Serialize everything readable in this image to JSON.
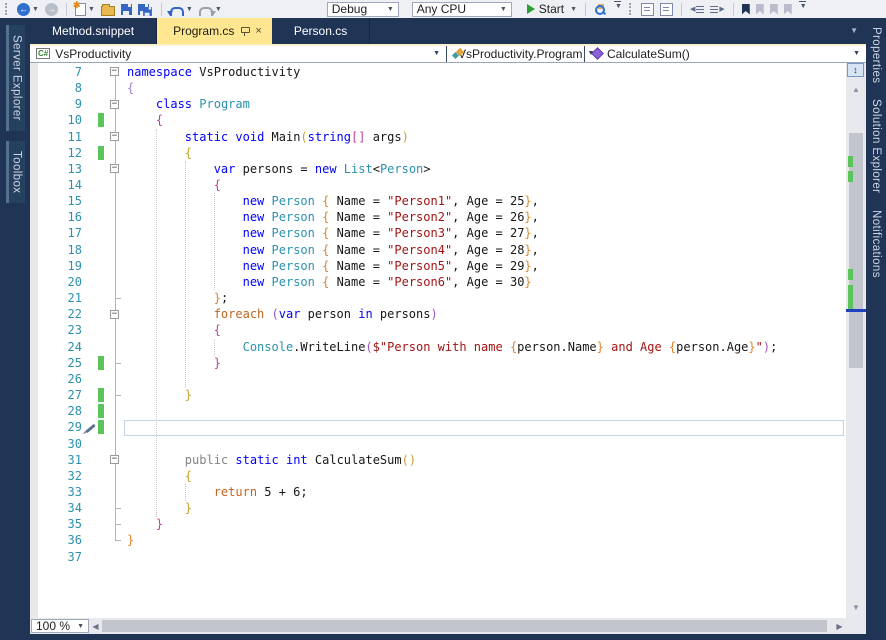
{
  "toolbar": {
    "debug_target": "Debug",
    "platform": "Any CPU",
    "start_label": "Start"
  },
  "tabs": [
    {
      "label": "Method.snippet",
      "active": false
    },
    {
      "label": "Program.cs",
      "active": true
    },
    {
      "label": "Person.cs",
      "active": false
    }
  ],
  "navbar": {
    "project": "VsProductivity",
    "type": "VsProductivity.Program",
    "member": "CalculateSum()",
    "project_icon_text": "C#"
  },
  "left_panels": [
    "Server Explorer",
    "Toolbox"
  ],
  "right_panels": [
    "Properties",
    "Solution Explorer",
    "Notifications"
  ],
  "statusbar": {
    "zoom_level": "100 %"
  },
  "icons": {
    "fold_expanded": "−"
  },
  "editor": {
    "caret_line": 29,
    "lines": [
      {
        "n": 7,
        "fold": true,
        "tokens": [
          [
            "kw",
            "namespace"
          ],
          [
            "pl",
            " VsProductivity"
          ]
        ]
      },
      {
        "n": 8,
        "tokens": [
          [
            "bl",
            "{"
          ]
        ]
      },
      {
        "n": 9,
        "fold": true,
        "tokens": [
          [
            "pl",
            "    "
          ],
          [
            "kw",
            "class"
          ],
          [
            "pl",
            " "
          ],
          [
            "ty",
            "Program"
          ]
        ]
      },
      {
        "n": 10,
        "chg": true,
        "tokens": [
          [
            "pl",
            "    "
          ],
          [
            "bm",
            "{"
          ]
        ]
      },
      {
        "n": 11,
        "fold": true,
        "tokens": [
          [
            "pl",
            "        "
          ],
          [
            "kw",
            "static"
          ],
          [
            "pl",
            " "
          ],
          [
            "kw",
            "void"
          ],
          [
            "pl",
            " Main"
          ],
          [
            "bg",
            "("
          ],
          [
            "kw",
            "string"
          ],
          [
            "bm",
            "[]"
          ],
          [
            "pl",
            " args"
          ],
          [
            "bg",
            ")"
          ]
        ]
      },
      {
        "n": 12,
        "chg": true,
        "tokens": [
          [
            "pl",
            "        "
          ],
          [
            "bg",
            "{"
          ]
        ]
      },
      {
        "n": 13,
        "fold": true,
        "tokens": [
          [
            "pl",
            "            "
          ],
          [
            "kw",
            "var"
          ],
          [
            "pl",
            " persons = "
          ],
          [
            "kw",
            "new"
          ],
          [
            "pl",
            " "
          ],
          [
            "ty",
            "List"
          ],
          [
            "pl",
            "<"
          ],
          [
            "ty",
            "Person"
          ],
          [
            "pl",
            ">"
          ]
        ]
      },
      {
        "n": 14,
        "tokens": [
          [
            "pl",
            "            "
          ],
          [
            "bm",
            "{"
          ]
        ]
      },
      {
        "n": 15,
        "tokens": [
          [
            "pl",
            "                "
          ],
          [
            "kw",
            "new"
          ],
          [
            "pl",
            " "
          ],
          [
            "ty",
            "Person"
          ],
          [
            "pl",
            " "
          ],
          [
            "bo",
            "{"
          ],
          [
            "pl",
            " Name = "
          ],
          [
            "str",
            "\"Person1\""
          ],
          [
            "pl",
            ", Age = 25"
          ],
          [
            "bo",
            "}"
          ],
          [
            "pl",
            ","
          ]
        ]
      },
      {
        "n": 16,
        "tokens": [
          [
            "pl",
            "                "
          ],
          [
            "kw",
            "new"
          ],
          [
            "pl",
            " "
          ],
          [
            "ty",
            "Person"
          ],
          [
            "pl",
            " "
          ],
          [
            "bo",
            "{"
          ],
          [
            "pl",
            " Name = "
          ],
          [
            "str",
            "\"Person2\""
          ],
          [
            "pl",
            ", Age = 26"
          ],
          [
            "bo",
            "}"
          ],
          [
            "pl",
            ","
          ]
        ]
      },
      {
        "n": 17,
        "tokens": [
          [
            "pl",
            "                "
          ],
          [
            "kw",
            "new"
          ],
          [
            "pl",
            " "
          ],
          [
            "ty",
            "Person"
          ],
          [
            "pl",
            " "
          ],
          [
            "bo",
            "{"
          ],
          [
            "pl",
            " Name = "
          ],
          [
            "str",
            "\"Person3\""
          ],
          [
            "pl",
            ", Age = 27"
          ],
          [
            "bo",
            "}"
          ],
          [
            "pl",
            ","
          ]
        ]
      },
      {
        "n": 18,
        "tokens": [
          [
            "pl",
            "                "
          ],
          [
            "kw",
            "new"
          ],
          [
            "pl",
            " "
          ],
          [
            "ty",
            "Person"
          ],
          [
            "pl",
            " "
          ],
          [
            "bo",
            "{"
          ],
          [
            "pl",
            " Name = "
          ],
          [
            "str",
            "\"Person4\""
          ],
          [
            "pl",
            ", Age = 28"
          ],
          [
            "bo",
            "}"
          ],
          [
            "pl",
            ","
          ]
        ]
      },
      {
        "n": 19,
        "tokens": [
          [
            "pl",
            "                "
          ],
          [
            "kw",
            "new"
          ],
          [
            "pl",
            " "
          ],
          [
            "ty",
            "Person"
          ],
          [
            "pl",
            " "
          ],
          [
            "bo",
            "{"
          ],
          [
            "pl",
            " Name = "
          ],
          [
            "str",
            "\"Person5\""
          ],
          [
            "pl",
            ", Age = 29"
          ],
          [
            "bo",
            "}"
          ],
          [
            "pl",
            ","
          ]
        ]
      },
      {
        "n": 20,
        "tokens": [
          [
            "pl",
            "                "
          ],
          [
            "kw",
            "new"
          ],
          [
            "pl",
            " "
          ],
          [
            "ty",
            "Person"
          ],
          [
            "pl",
            " "
          ],
          [
            "bo",
            "{"
          ],
          [
            "pl",
            " Name = "
          ],
          [
            "str",
            "\"Person6\""
          ],
          [
            "pl",
            ", Age = 30"
          ],
          [
            "bo",
            "}"
          ]
        ]
      },
      {
        "n": 21,
        "tick": true,
        "tokens": [
          [
            "pl",
            "            "
          ],
          [
            "bo",
            "}"
          ],
          [
            "pl",
            ";"
          ]
        ]
      },
      {
        "n": 22,
        "fold": true,
        "tokens": [
          [
            "pl",
            "            "
          ],
          [
            "ctrl",
            "foreach"
          ],
          [
            "pl",
            " "
          ],
          [
            "bp",
            "("
          ],
          [
            "kw",
            "var"
          ],
          [
            "pl",
            " person "
          ],
          [
            "kw",
            "in"
          ],
          [
            "pl",
            " persons"
          ],
          [
            "bp",
            ")"
          ]
        ]
      },
      {
        "n": 23,
        "tokens": [
          [
            "pl",
            "            "
          ],
          [
            "bm",
            "{"
          ]
        ]
      },
      {
        "n": 24,
        "tokens": [
          [
            "pl",
            "                "
          ],
          [
            "ty",
            "Console"
          ],
          [
            "pl",
            ".WriteLine"
          ],
          [
            "bp",
            "("
          ],
          [
            "str",
            "$\"Person with name "
          ],
          [
            "bo",
            "{"
          ],
          [
            "pl",
            "person.Name"
          ],
          [
            "bo",
            "}"
          ],
          [
            "str",
            " and Age "
          ],
          [
            "bo",
            "{"
          ],
          [
            "pl",
            "person.Age"
          ],
          [
            "bo",
            "}"
          ],
          [
            "str",
            "\""
          ],
          [
            "bp",
            ")"
          ],
          [
            "pl",
            ";"
          ]
        ]
      },
      {
        "n": 25,
        "chg": true,
        "tick": true,
        "tokens": [
          [
            "pl",
            "            "
          ],
          [
            "bm",
            "}"
          ]
        ]
      },
      {
        "n": 26,
        "tokens": []
      },
      {
        "n": 27,
        "chg": true,
        "tick": true,
        "tokens": [
          [
            "pl",
            "        "
          ],
          [
            "bg",
            "}"
          ]
        ]
      },
      {
        "n": 28,
        "chg": true,
        "tokens": []
      },
      {
        "n": 29,
        "chg": true,
        "tokens": []
      },
      {
        "n": 30,
        "tokens": []
      },
      {
        "n": 31,
        "fold": true,
        "tokens": [
          [
            "pl",
            "        "
          ],
          [
            "gray",
            "public"
          ],
          [
            "pl",
            " "
          ],
          [
            "kw",
            "static"
          ],
          [
            "pl",
            " "
          ],
          [
            "kw",
            "int"
          ],
          [
            "pl",
            " CalculateSum"
          ],
          [
            "bg",
            "("
          ],
          [
            "bg",
            ")"
          ]
        ]
      },
      {
        "n": 32,
        "tokens": [
          [
            "pl",
            "        "
          ],
          [
            "bg",
            "{"
          ]
        ]
      },
      {
        "n": 33,
        "tokens": [
          [
            "pl",
            "            "
          ],
          [
            "ctrl",
            "return"
          ],
          [
            "pl",
            " 5 + 6;"
          ]
        ]
      },
      {
        "n": 34,
        "tick": true,
        "tokens": [
          [
            "pl",
            "        "
          ],
          [
            "bg",
            "}"
          ]
        ]
      },
      {
        "n": 35,
        "tick": true,
        "tokens": [
          [
            "pl",
            "    "
          ],
          [
            "bm",
            "}"
          ]
        ]
      },
      {
        "n": 36,
        "tick": true,
        "tokens": [
          [
            "bo",
            "}"
          ]
        ]
      },
      {
        "n": 37,
        "tokens": []
      }
    ]
  }
}
